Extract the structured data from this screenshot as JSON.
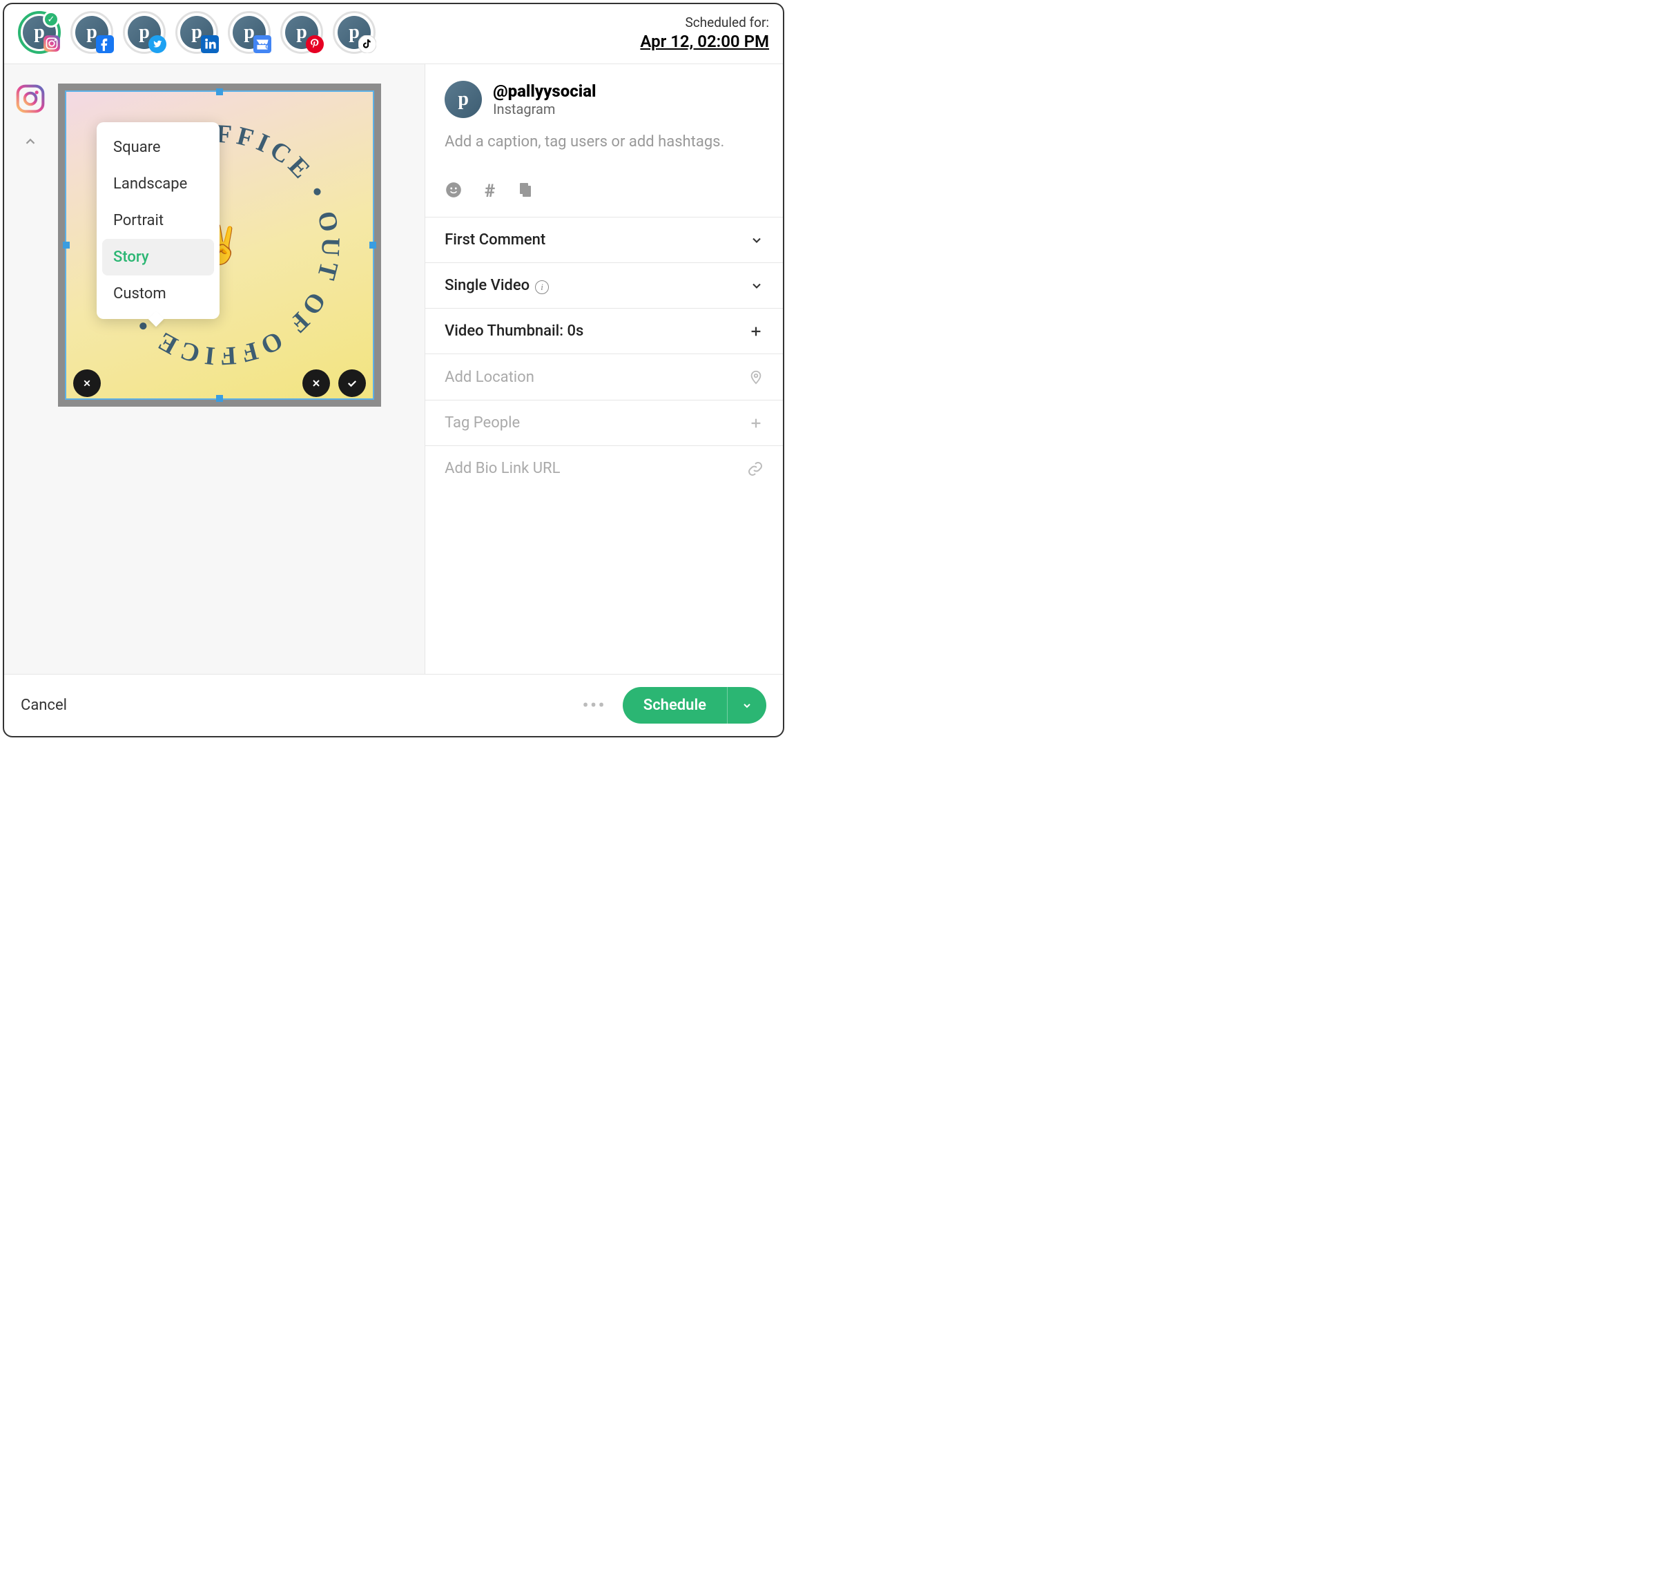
{
  "header": {
    "scheduled_label": "Scheduled for:",
    "scheduled_time": "Apr 12, 02:00 PM",
    "accounts": [
      {
        "network": "instagram",
        "active": true
      },
      {
        "network": "facebook",
        "active": false
      },
      {
        "network": "twitter",
        "active": false
      },
      {
        "network": "linkedin",
        "active": false
      },
      {
        "network": "google",
        "active": false
      },
      {
        "network": "pinterest",
        "active": false
      },
      {
        "network": "tiktok",
        "active": false
      }
    ]
  },
  "crop_menu": {
    "items": [
      {
        "label": "Square",
        "selected": false
      },
      {
        "label": "Landscape",
        "selected": false
      },
      {
        "label": "Portrait",
        "selected": false
      },
      {
        "label": "Story",
        "selected": true
      },
      {
        "label": "Custom",
        "selected": false
      }
    ]
  },
  "preview": {
    "circle_text": "OUT OF OFFICE • OUT OF OFFICE •",
    "emoji": "peace-hand"
  },
  "compose": {
    "handle": "@pallyysocial",
    "platform": "Instagram",
    "caption_placeholder": "Add a caption, tag users or add hashtags.",
    "rows": [
      {
        "label": "First Comment",
        "icon": "chevron",
        "disabled": false
      },
      {
        "label": "Single Video",
        "icon": "chevron",
        "info": true,
        "disabled": false
      },
      {
        "label": "Video Thumbnail: 0s",
        "icon": "plus",
        "disabled": false
      },
      {
        "label": "Add Location",
        "icon": "pin",
        "disabled": true
      },
      {
        "label": "Tag People",
        "icon": "plus",
        "disabled": true
      },
      {
        "label": "Add Bio Link URL",
        "icon": "link",
        "disabled": true
      }
    ]
  },
  "footer": {
    "cancel": "Cancel",
    "more": "•••",
    "schedule": "Schedule"
  },
  "colors": {
    "accent": "#2bb673",
    "brand": "#3d5d72"
  }
}
